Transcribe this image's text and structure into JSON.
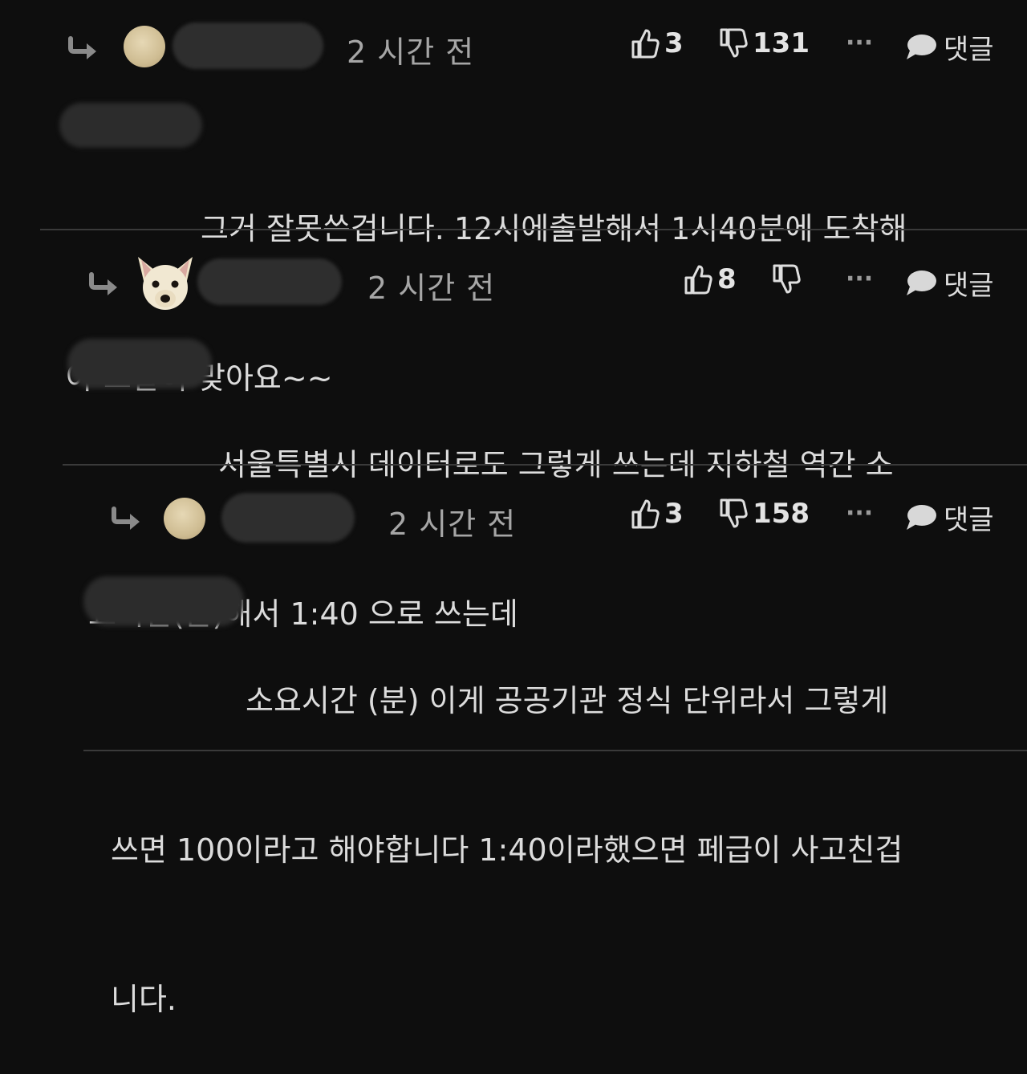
{
  "comments": [
    {
      "time": "2 시간 전",
      "likes": "3",
      "dislikes": "131",
      "more": "···",
      "reply_label": "댓글",
      "text_line1": "그거 잘못쓴겁니다. 12시에출발해서 1시40분에 도착해",
      "text_line2": "야 그말이 맞아요~~"
    },
    {
      "time": "2 시간 전",
      "likes": "8",
      "dislikes": "",
      "more": "···",
      "reply_label": "댓글",
      "text_line1": "서울특별시 데이터로도 그렇게 쓰는데 지하철 역간 소",
      "text_line2": "요시간(분)해서 1:40 으로 쓰는데"
    },
    {
      "time": "2 시간 전",
      "likes": "3",
      "dislikes": "158",
      "more": "···",
      "reply_label": "댓글",
      "text_line1": "소요시간 (분) 이게 공공기관 정식 단위라서 그렇게",
      "text_line2": "쓰면 100이라고 해야합니다 1:40이라했으면 페급이 사고친겁",
      "text_line3": "니다."
    }
  ],
  "icons": {
    "reply_arrow": "reply-arrow-icon",
    "thumbs_up": "thumbs-up-icon",
    "thumbs_down": "thumbs-down-icon",
    "more": "more-icon",
    "comment": "comment-bubble-icon"
  },
  "colors": {
    "background": "#0e0e0e",
    "text": "#dcdcdc",
    "muted": "#a6a6a6",
    "divider": "#3a3a3a"
  }
}
